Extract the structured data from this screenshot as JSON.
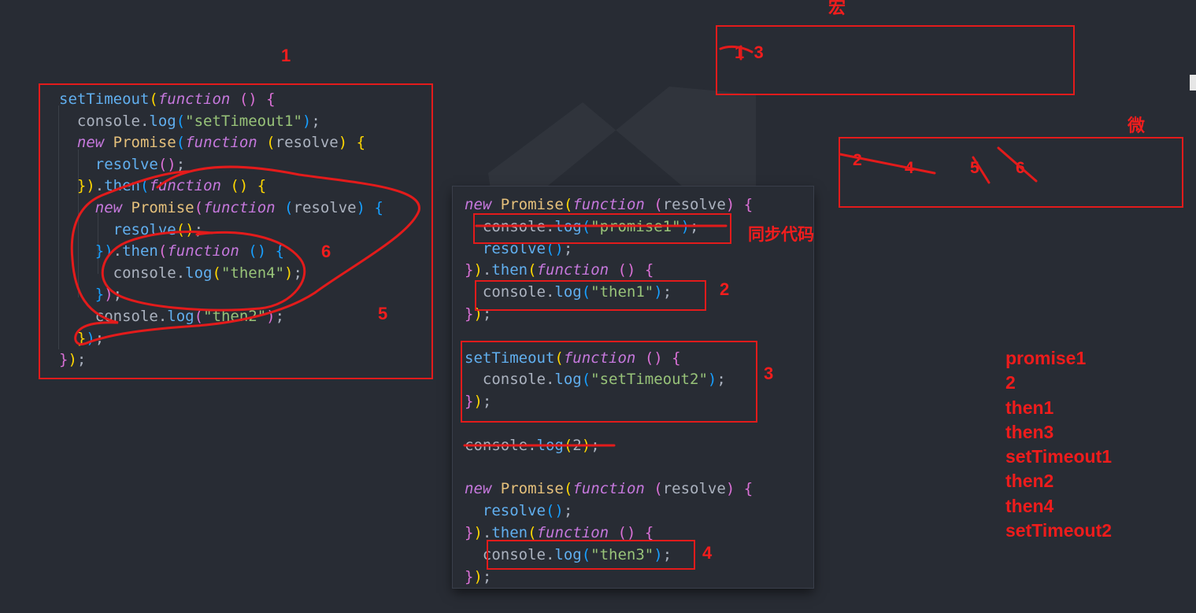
{
  "panel1": {
    "lines": [
      [
        {
          "c": "fn",
          "t": "setTimeout"
        },
        {
          "c": "y",
          "t": "("
        },
        {
          "c": "kw",
          "t": "function"
        },
        {
          "c": "",
          "t": " "
        },
        {
          "c": "p",
          "t": "()"
        },
        {
          "c": "",
          "t": " "
        },
        {
          "c": "p",
          "t": "{"
        }
      ],
      [
        {
          "c": "",
          "t": "  console."
        },
        {
          "c": "fn",
          "t": "log"
        },
        {
          "c": "b",
          "t": "("
        },
        {
          "c": "str",
          "t": "\"setTimeout1\""
        },
        {
          "c": "b",
          "t": ")"
        },
        {
          "c": "",
          "t": ";"
        }
      ],
      [
        {
          "c": "",
          "t": "  "
        },
        {
          "c": "kw",
          "t": "new"
        },
        {
          "c": "",
          "t": " "
        },
        {
          "c": "cls",
          "t": "Promise"
        },
        {
          "c": "b",
          "t": "("
        },
        {
          "c": "kw",
          "t": "function"
        },
        {
          "c": "",
          "t": " "
        },
        {
          "c": "y",
          "t": "("
        },
        {
          "c": "",
          "t": "resolve"
        },
        {
          "c": "y",
          "t": ")"
        },
        {
          "c": "",
          "t": " "
        },
        {
          "c": "y",
          "t": "{"
        }
      ],
      [
        {
          "c": "",
          "t": "    "
        },
        {
          "c": "fn",
          "t": "resolve"
        },
        {
          "c": "p",
          "t": "()"
        },
        {
          "c": "",
          "t": ";"
        }
      ],
      [
        {
          "c": "",
          "t": "  "
        },
        {
          "c": "y",
          "t": "})"
        },
        {
          "c": "",
          "t": "."
        },
        {
          "c": "fn",
          "t": "then"
        },
        {
          "c": "b",
          "t": "("
        },
        {
          "c": "kw",
          "t": "function"
        },
        {
          "c": "",
          "t": " "
        },
        {
          "c": "y",
          "t": "()"
        },
        {
          "c": "",
          "t": " "
        },
        {
          "c": "y",
          "t": "{"
        }
      ],
      [
        {
          "c": "",
          "t": "    "
        },
        {
          "c": "kw",
          "t": "new"
        },
        {
          "c": "",
          "t": " "
        },
        {
          "c": "cls",
          "t": "Promise"
        },
        {
          "c": "p",
          "t": "("
        },
        {
          "c": "kw",
          "t": "function"
        },
        {
          "c": "",
          "t": " "
        },
        {
          "c": "b",
          "t": "("
        },
        {
          "c": "",
          "t": "resolve"
        },
        {
          "c": "b",
          "t": ")"
        },
        {
          "c": "",
          "t": " "
        },
        {
          "c": "b",
          "t": "{"
        }
      ],
      [
        {
          "c": "",
          "t": "      "
        },
        {
          "c": "fn",
          "t": "resolve"
        },
        {
          "c": "y",
          "t": "()"
        },
        {
          "c": "",
          "t": ";"
        }
      ],
      [
        {
          "c": "",
          "t": "    "
        },
        {
          "c": "b",
          "t": "})"
        },
        {
          "c": "",
          "t": "."
        },
        {
          "c": "fn",
          "t": "then"
        },
        {
          "c": "p",
          "t": "("
        },
        {
          "c": "kw",
          "t": "function"
        },
        {
          "c": "",
          "t": " "
        },
        {
          "c": "b",
          "t": "()"
        },
        {
          "c": "",
          "t": " "
        },
        {
          "c": "b",
          "t": "{"
        }
      ],
      [
        {
          "c": "",
          "t": "      console."
        },
        {
          "c": "fn",
          "t": "log"
        },
        {
          "c": "y",
          "t": "("
        },
        {
          "c": "str",
          "t": "\"then4\""
        },
        {
          "c": "y",
          "t": ")"
        },
        {
          "c": "",
          "t": ";"
        }
      ],
      [
        {
          "c": "",
          "t": "    "
        },
        {
          "c": "b",
          "t": "}"
        },
        {
          "c": "p",
          "t": ")"
        },
        {
          "c": "",
          "t": ";"
        }
      ],
      [
        {
          "c": "",
          "t": "    console."
        },
        {
          "c": "fn",
          "t": "log"
        },
        {
          "c": "p",
          "t": "("
        },
        {
          "c": "str",
          "t": "\"then2\""
        },
        {
          "c": "p",
          "t": ")"
        },
        {
          "c": "",
          "t": ";"
        }
      ],
      [
        {
          "c": "",
          "t": "  "
        },
        {
          "c": "y",
          "t": "}"
        },
        {
          "c": "b",
          "t": ")"
        },
        {
          "c": "",
          "t": ";"
        }
      ],
      [
        {
          "c": "p",
          "t": "}"
        },
        {
          "c": "y",
          "t": ")"
        },
        {
          "c": "",
          "t": ";"
        }
      ]
    ]
  },
  "panel2": {
    "lines": [
      [
        {
          "c": "kw",
          "t": "new"
        },
        {
          "c": "",
          "t": " "
        },
        {
          "c": "cls",
          "t": "Promise"
        },
        {
          "c": "y",
          "t": "("
        },
        {
          "c": "kw",
          "t": "function"
        },
        {
          "c": "",
          "t": " "
        },
        {
          "c": "p",
          "t": "("
        },
        {
          "c": "",
          "t": "resolve"
        },
        {
          "c": "p",
          "t": ")"
        },
        {
          "c": "",
          "t": " "
        },
        {
          "c": "p",
          "t": "{"
        }
      ],
      [
        {
          "c": "",
          "t": "  console."
        },
        {
          "c": "fn",
          "t": "log"
        },
        {
          "c": "b",
          "t": "("
        },
        {
          "c": "str",
          "t": "\"promise1\""
        },
        {
          "c": "b",
          "t": ")"
        },
        {
          "c": "",
          "t": ";"
        }
      ],
      [
        {
          "c": "",
          "t": "  "
        },
        {
          "c": "fn",
          "t": "resolve"
        },
        {
          "c": "b",
          "t": "()"
        },
        {
          "c": "",
          "t": ";"
        }
      ],
      [
        {
          "c": "p",
          "t": "}"
        },
        {
          "c": "y",
          "t": ")"
        },
        {
          "c": "",
          "t": "."
        },
        {
          "c": "fn",
          "t": "then"
        },
        {
          "c": "y",
          "t": "("
        },
        {
          "c": "kw",
          "t": "function"
        },
        {
          "c": "",
          "t": " "
        },
        {
          "c": "p",
          "t": "()"
        },
        {
          "c": "",
          "t": " "
        },
        {
          "c": "p",
          "t": "{"
        }
      ],
      [
        {
          "c": "",
          "t": "  console."
        },
        {
          "c": "fn",
          "t": "log"
        },
        {
          "c": "b",
          "t": "("
        },
        {
          "c": "str",
          "t": "\"then1\""
        },
        {
          "c": "b",
          "t": ")"
        },
        {
          "c": "",
          "t": ";"
        }
      ],
      [
        {
          "c": "p",
          "t": "}"
        },
        {
          "c": "y",
          "t": ")"
        },
        {
          "c": "",
          "t": ";"
        }
      ],
      [
        {
          "c": "",
          "t": ""
        }
      ],
      [
        {
          "c": "fn",
          "t": "setTimeout"
        },
        {
          "c": "y",
          "t": "("
        },
        {
          "c": "kw",
          "t": "function"
        },
        {
          "c": "",
          "t": " "
        },
        {
          "c": "p",
          "t": "()"
        },
        {
          "c": "",
          "t": " "
        },
        {
          "c": "p",
          "t": "{"
        }
      ],
      [
        {
          "c": "",
          "t": "  console."
        },
        {
          "c": "fn",
          "t": "log"
        },
        {
          "c": "b",
          "t": "("
        },
        {
          "c": "str",
          "t": "\"setTimeout2\""
        },
        {
          "c": "b",
          "t": ")"
        },
        {
          "c": "",
          "t": ";"
        }
      ],
      [
        {
          "c": "p",
          "t": "}"
        },
        {
          "c": "y",
          "t": ")"
        },
        {
          "c": "",
          "t": ";"
        }
      ],
      [
        {
          "c": "",
          "t": ""
        }
      ],
      [
        {
          "c": "",
          "t": "console."
        },
        {
          "c": "fn",
          "t": "log"
        },
        {
          "c": "y",
          "t": "("
        },
        {
          "c": "",
          "t": "2"
        },
        {
          "c": "y",
          "t": ")"
        },
        {
          "c": "",
          "t": ";"
        }
      ],
      [
        {
          "c": "",
          "t": ""
        }
      ],
      [
        {
          "c": "kw",
          "t": "new"
        },
        {
          "c": "",
          "t": " "
        },
        {
          "c": "cls",
          "t": "Promise"
        },
        {
          "c": "y",
          "t": "("
        },
        {
          "c": "kw",
          "t": "function"
        },
        {
          "c": "",
          "t": " "
        },
        {
          "c": "p",
          "t": "("
        },
        {
          "c": "",
          "t": "resolve"
        },
        {
          "c": "p",
          "t": ")"
        },
        {
          "c": "",
          "t": " "
        },
        {
          "c": "p",
          "t": "{"
        }
      ],
      [
        {
          "c": "",
          "t": "  "
        },
        {
          "c": "fn",
          "t": "resolve"
        },
        {
          "c": "b",
          "t": "()"
        },
        {
          "c": "",
          "t": ";"
        }
      ],
      [
        {
          "c": "p",
          "t": "}"
        },
        {
          "c": "y",
          "t": ")"
        },
        {
          "c": "",
          "t": "."
        },
        {
          "c": "fn",
          "t": "then"
        },
        {
          "c": "y",
          "t": "("
        },
        {
          "c": "kw",
          "t": "function"
        },
        {
          "c": "",
          "t": " "
        },
        {
          "c": "p",
          "t": "()"
        },
        {
          "c": "",
          "t": " "
        },
        {
          "c": "p",
          "t": "{"
        }
      ],
      [
        {
          "c": "",
          "t": "  console."
        },
        {
          "c": "fn",
          "t": "log"
        },
        {
          "c": "b",
          "t": "("
        },
        {
          "c": "str",
          "t": "\"then3\""
        },
        {
          "c": "b",
          "t": ")"
        },
        {
          "c": "",
          "t": ";"
        }
      ],
      [
        {
          "c": "p",
          "t": "}"
        },
        {
          "c": "y",
          "t": ")"
        },
        {
          "c": "",
          "t": ";"
        }
      ]
    ]
  },
  "annotations": {
    "label_1": "1",
    "label_macro": "宏",
    "label_macro_items": "1  3",
    "label_micro": "微",
    "label_micro_items": [
      "2",
      "4",
      "5",
      "6"
    ],
    "label_sync": "同步代码",
    "label_p1_6": "6",
    "label_p1_5": "5",
    "label_p2_2": "2",
    "label_p2_3": "3",
    "label_p2_4": "4"
  },
  "output": [
    "promise1",
    "2",
    "then1",
    "then3",
    "setTimeout1",
    "then2",
    "then4",
    "setTimeout2"
  ],
  "colors": {
    "background": "#282c34",
    "annotation": "#e31b1b"
  }
}
